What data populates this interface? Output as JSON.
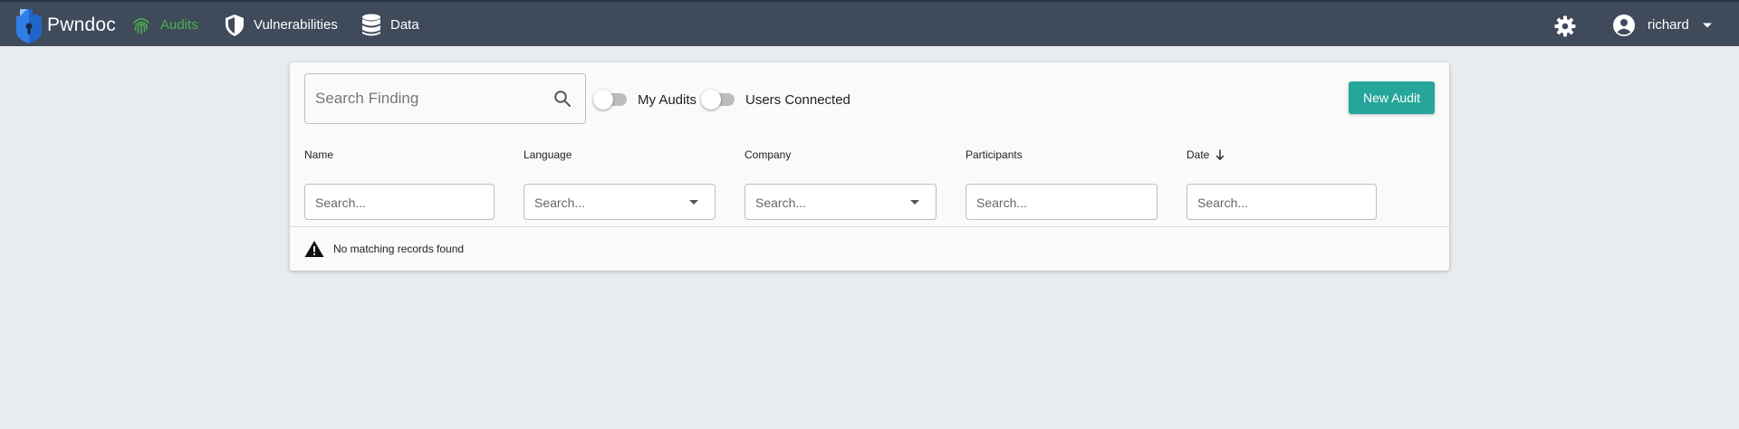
{
  "header": {
    "brand": "Pwndoc",
    "nav": [
      {
        "label": "Audits",
        "icon": "fingerprint-icon",
        "active": true
      },
      {
        "label": "Vulnerabilities",
        "icon": "shield-icon",
        "active": false
      },
      {
        "label": "Data",
        "icon": "database-icon",
        "active": false
      }
    ],
    "settings_icon": "gear-icon",
    "user": {
      "name": "richard",
      "icon": "account-circle-icon"
    }
  },
  "toolbar": {
    "search_placeholder": "Search Finding",
    "toggles": [
      {
        "label": "My Audits",
        "checked": false
      },
      {
        "label": "Users Connected",
        "checked": false
      }
    ],
    "new_audit_label": "New Audit"
  },
  "table": {
    "columns": [
      {
        "label": "Name",
        "filter_placeholder": "Search...",
        "filter_type": "text",
        "sorted": null
      },
      {
        "label": "Language",
        "filter_placeholder": "Search...",
        "filter_type": "select",
        "sorted": null
      },
      {
        "label": "Company",
        "filter_placeholder": "Search...",
        "filter_type": "select",
        "sorted": null
      },
      {
        "label": "Participants",
        "filter_placeholder": "Search...",
        "filter_type": "text",
        "sorted": null
      },
      {
        "label": "Date",
        "filter_placeholder": "Search...",
        "filter_type": "text",
        "sorted": "desc"
      }
    ],
    "empty_message": "No matching records found"
  },
  "colors": {
    "topbar": "#3f4a5b",
    "active_nav": "#4caf50",
    "primary_button": "#26a69a",
    "background": "#e8ecef"
  }
}
